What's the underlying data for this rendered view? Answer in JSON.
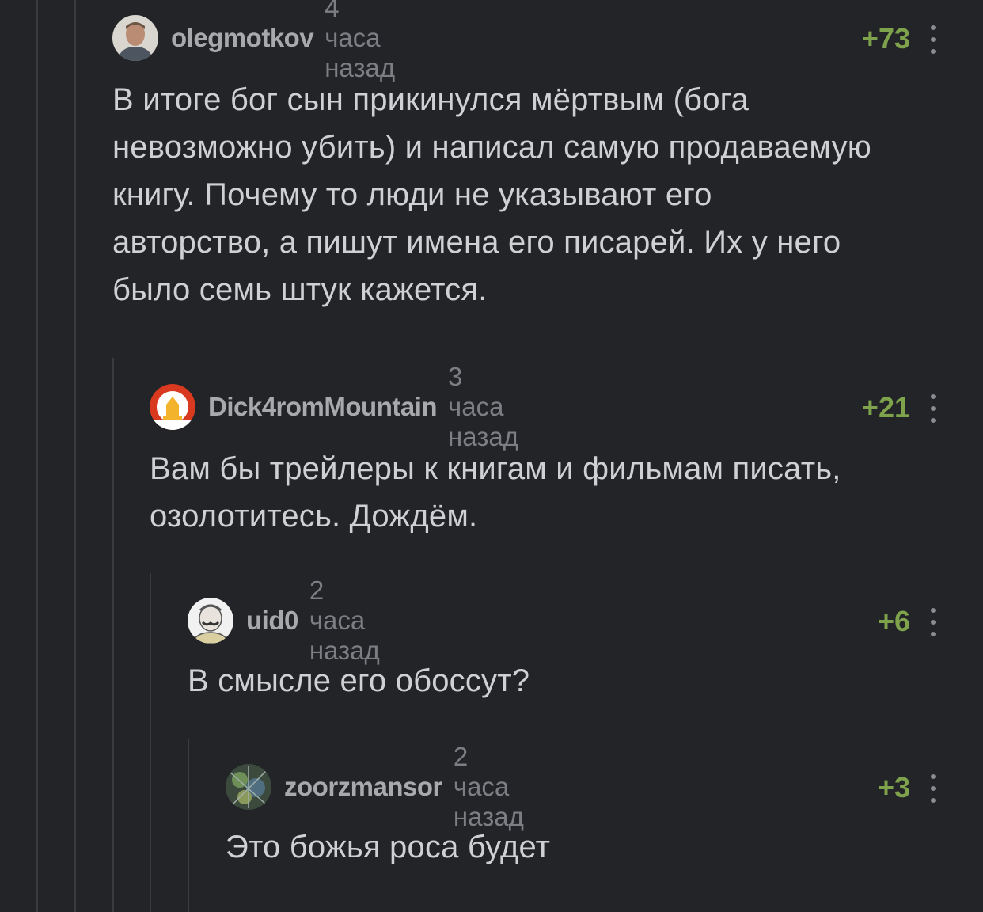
{
  "comments": [
    {
      "username": "olegmotkov",
      "time": "4 часа назад",
      "rating": "+73",
      "text": "В итоге бог сын прикинулся мёртвым (бога невозможно убить) и написал самую продаваемую книгу. Почему то люди не указывают его авторство, а пишут имена его писарей. Их у него было семь штук кажется."
    },
    {
      "username": "Dick4romMountain",
      "time": "3 часа назад",
      "rating": "+21",
      "text": "Вам бы трейлеры к книгам и фильмам писать, озолотитесь. Дождём."
    },
    {
      "username": "uid0",
      "time": "2 часа назад",
      "rating": "+6",
      "text": "В смысле его обоссут?"
    },
    {
      "username": "zoorzmansor",
      "time": "2 часа назад",
      "rating": "+3",
      "text": "Это божья роса будет"
    }
  ],
  "icons": {
    "menu": "more-vertical-icon"
  },
  "colors": {
    "background": "#232427",
    "rating": "#7ea34c",
    "username": "#a7a9ad",
    "time": "#7c7e83",
    "text": "#cfd0d4"
  }
}
